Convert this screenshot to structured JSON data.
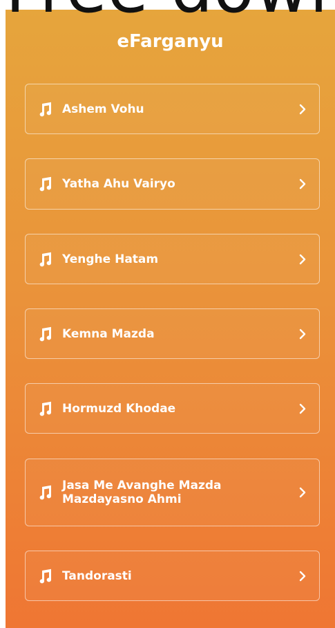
{
  "header_crop_text": "Free downlo",
  "app": {
    "title": "eFarganyu"
  },
  "list": {
    "items": [
      {
        "label": "Ashem Vohu",
        "icon": "music-note-icon"
      },
      {
        "label": "Yatha Ahu Vairyo",
        "icon": "music-note-icon"
      },
      {
        "label": "Yenghe Hatam",
        "icon": "music-note-icon"
      },
      {
        "label": "Kemna Mazda",
        "icon": "music-note-icon"
      },
      {
        "label": "Hormuzd Khodae",
        "icon": "music-note-icon"
      },
      {
        "label": "Jasa Me Avanghe Mazda Mazdayasno Ahmi",
        "icon": "music-note-icon"
      },
      {
        "label": "Tandorasti",
        "icon": "music-note-icon"
      }
    ]
  },
  "colors": {
    "gradient_top": "#e6a53c",
    "gradient_bottom": "#ef7633",
    "text": "#ffffff"
  }
}
